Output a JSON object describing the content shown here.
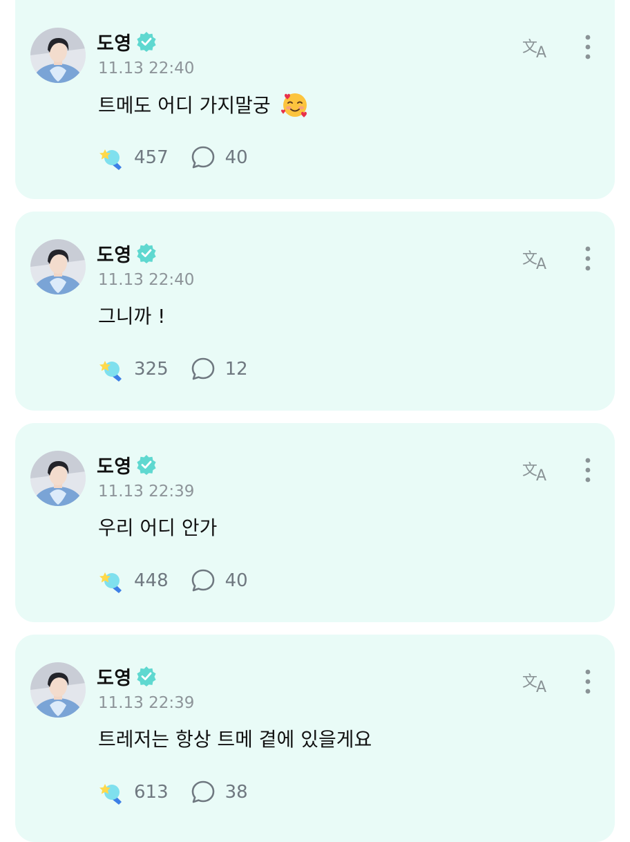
{
  "colors": {
    "card_background": "#e9fbf7",
    "verified": "#5fd8d0",
    "text_primary": "#111111",
    "text_secondary": "#8d9499",
    "icon_gray": "#8a9396"
  },
  "posts": [
    {
      "author": "도영",
      "timestamp": "11.13 22:40",
      "text": "트메도 어디 가지말궁",
      "emoji": "smiling-face-with-hearts",
      "likes": "457",
      "comments": "40"
    },
    {
      "author": "도영",
      "timestamp": "11.13 22:40",
      "text": "그니까 !",
      "likes": "325",
      "comments": "12"
    },
    {
      "author": "도영",
      "timestamp": "11.13 22:39",
      "text": "우리 어디 안가",
      "likes": "448",
      "comments": "40"
    },
    {
      "author": "도영",
      "timestamp": "11.13 22:39",
      "text": "트레저는 항상 트메 곁에 있을게요",
      "likes": "613",
      "comments": "38"
    }
  ]
}
